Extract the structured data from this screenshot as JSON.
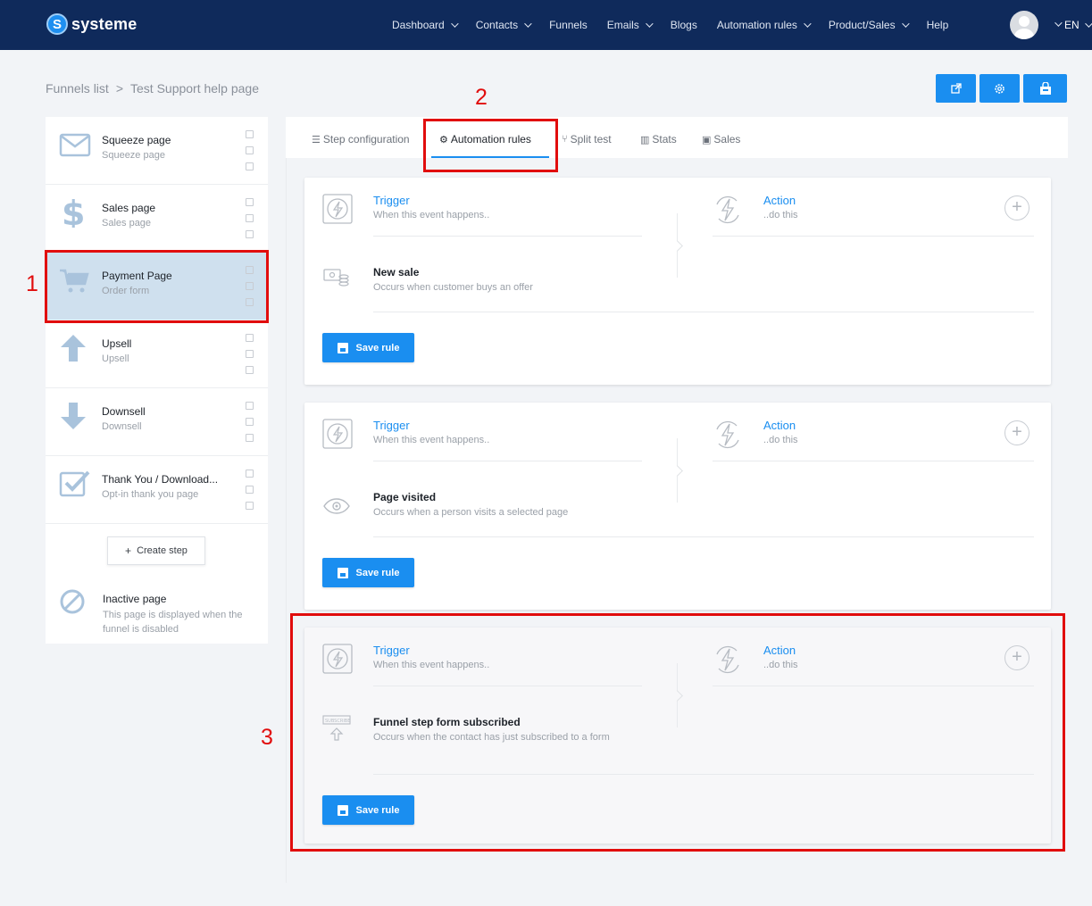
{
  "app": {
    "logo_text": "systeme"
  },
  "nav": {
    "items": [
      {
        "label": "Dashboard",
        "dropdown": true
      },
      {
        "label": "Contacts",
        "dropdown": true
      },
      {
        "label": "Funnels",
        "dropdown": false
      },
      {
        "label": "Emails",
        "dropdown": true
      },
      {
        "label": "Blogs",
        "dropdown": false
      },
      {
        "label": "Automation rules",
        "dropdown": true
      },
      {
        "label": "Product/Sales",
        "dropdown": true
      },
      {
        "label": "Help",
        "dropdown": false
      }
    ],
    "language": "EN"
  },
  "breadcrumb": {
    "parent": "Funnels list",
    "separator": ">",
    "current": "Test Support help page"
  },
  "top_actions": [
    {
      "icon": "external-link-icon"
    },
    {
      "icon": "settings-icon"
    },
    {
      "icon": "funnel-store-icon"
    }
  ],
  "sidebar": {
    "steps": [
      {
        "name": "Squeeze page",
        "type": "Squeeze page",
        "icon": "envelope-icon",
        "active": false
      },
      {
        "name": "Sales page",
        "type": "Sales page",
        "icon": "dollar-icon",
        "active": false
      },
      {
        "name": "Payment Page",
        "type": "Order form",
        "icon": "cart-icon",
        "active": true
      },
      {
        "name": "Upsell",
        "type": "Upsell",
        "icon": "arrow-up-icon",
        "active": false
      },
      {
        "name": "Downsell",
        "type": "Downsell",
        "icon": "arrow-down-icon",
        "active": false
      },
      {
        "name": "Thank You / Download...",
        "type": "Opt-in thank you page",
        "icon": "checkbox-icon",
        "active": false
      }
    ],
    "create_step_label": "Create step",
    "inactive": {
      "title": "Inactive page",
      "description": "This page is displayed when the funnel is disabled"
    }
  },
  "tabs": [
    {
      "label": "Step configuration",
      "icon": "list-icon",
      "active": false
    },
    {
      "label": "Automation rules",
      "icon": "gears-icon",
      "active": true
    },
    {
      "label": "Split test",
      "icon": "split-icon",
      "active": false
    },
    {
      "label": "Stats",
      "icon": "bar-chart-icon",
      "active": false
    },
    {
      "label": "Sales",
      "icon": "money-icon",
      "active": false
    }
  ],
  "rules": [
    {
      "trigger_title": "Trigger",
      "trigger_sub": "When this event happens..",
      "action_title": "Action",
      "action_sub": "..do this",
      "event_title": "New sale",
      "event_desc": "Occurs when customer buys an offer",
      "event_icon": "money-stack-icon",
      "save_label": "Save rule"
    },
    {
      "trigger_title": "Trigger",
      "trigger_sub": "When this event happens..",
      "action_title": "Action",
      "action_sub": "..do this",
      "event_title": "Page visited",
      "event_desc": "Occurs when a person visits a selected page",
      "event_icon": "eye-icon",
      "save_label": "Save rule"
    },
    {
      "trigger_title": "Trigger",
      "trigger_sub": "When this event happens..",
      "action_title": "Action",
      "action_sub": "..do this",
      "event_title": "Funnel step form subscribed",
      "event_desc": "Occurs when the contact has just subscribed to a form",
      "event_icon": "form-subscribe-icon",
      "event_icon_text": "SUBSCRIBE",
      "save_label": "Save rule"
    }
  ],
  "annotations": [
    {
      "label": "1"
    },
    {
      "label": "2"
    },
    {
      "label": "3"
    }
  ],
  "colors": {
    "nav_bg": "#0f2a5b",
    "accent": "#1a8ef0",
    "annotation": "#e10d0d",
    "active_step": "#cfe0ee"
  }
}
